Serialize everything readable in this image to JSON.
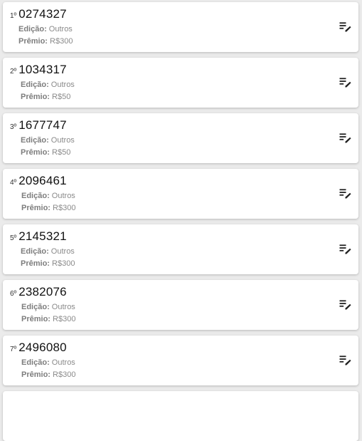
{
  "labels": {
    "edition": "Edição:",
    "prize": "Prêmio:"
  },
  "results": [
    {
      "rank": "1º",
      "number": "0274327",
      "edition": "Outros",
      "prize": "R$300"
    },
    {
      "rank": "2º",
      "number": "1034317",
      "edition": "Outros",
      "prize": "R$50"
    },
    {
      "rank": "3º",
      "number": "1677747",
      "edition": "Outros",
      "prize": "R$50"
    },
    {
      "rank": "4º",
      "number": "2096461",
      "edition": "Outros",
      "prize": "R$300"
    },
    {
      "rank": "5º",
      "number": "2145321",
      "edition": "Outros",
      "prize": "R$300"
    },
    {
      "rank": "6º",
      "number": "2382076",
      "edition": "Outros",
      "prize": "R$300"
    },
    {
      "rank": "7º",
      "number": "2496080",
      "edition": "Outros",
      "prize": "R$300"
    }
  ],
  "icons": {
    "action": "edit-list-icon"
  }
}
